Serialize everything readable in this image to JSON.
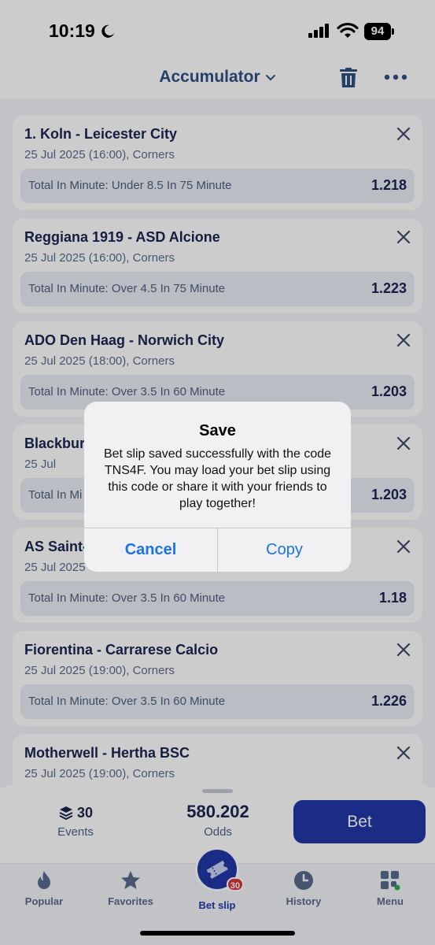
{
  "status_bar": {
    "time": "10:19",
    "battery": "94"
  },
  "header": {
    "title": "Accumulator"
  },
  "bets": [
    {
      "match": "1. Koln - Leicester City",
      "info": "25 Jul 2025 (16:00), Corners",
      "selection": "Total In Minute: Under 8.5 In 75 Minute",
      "odds": "1.218"
    },
    {
      "match": "Reggiana 1919 - ASD Alcione",
      "info": "25 Jul 2025 (16:00), Corners",
      "selection": "Total In Minute: Over 4.5 In 75 Minute",
      "odds": "1.223"
    },
    {
      "match": "ADO Den Haag - Norwich City",
      "info": "25 Jul 2025 (18:00), Corners",
      "selection": "Total In Minute: Over 3.5 In 60 Minute",
      "odds": "1.203"
    },
    {
      "match": "Blackbur",
      "info": "25 Jul",
      "selection": "Total In Mi",
      "odds": "1.203"
    },
    {
      "match": "AS Saint-",
      "info": "25 Jul 2025",
      "selection": "Total In Minute: Over 3.5 In 60 Minute",
      "odds": "1.18"
    },
    {
      "match": "Fiorentina - Carrarese Calcio",
      "info": "25 Jul 2025 (19:00), Corners",
      "selection": "Total In Minute: Over 3.5 In 60 Minute",
      "odds": "1.226"
    },
    {
      "match": "Motherwell - Hertha BSC",
      "info": "25 Jul 2025 (19:00), Corners",
      "selection": "",
      "odds": ""
    }
  ],
  "summary": {
    "events_count": "30",
    "events_label": "Events",
    "odds_value": "580.202",
    "odds_label": "Odds",
    "bet_button": "Bet"
  },
  "tabs": {
    "popular": "Popular",
    "favorites": "Favorites",
    "betslip": "Bet slip",
    "betslip_badge": "30",
    "history": "History",
    "menu": "Menu"
  },
  "dialog": {
    "title": "Save",
    "message": "Bet slip saved successfully with the code TNS4F. You may load your bet slip using this code or share it with your friends to play together!",
    "cancel": "Cancel",
    "copy": "Copy"
  },
  "colors": {
    "brand": "#2237a8",
    "title_blue": "#2f4f84",
    "badge_red": "#d8343a",
    "ios_blue": "#1a73e8"
  }
}
